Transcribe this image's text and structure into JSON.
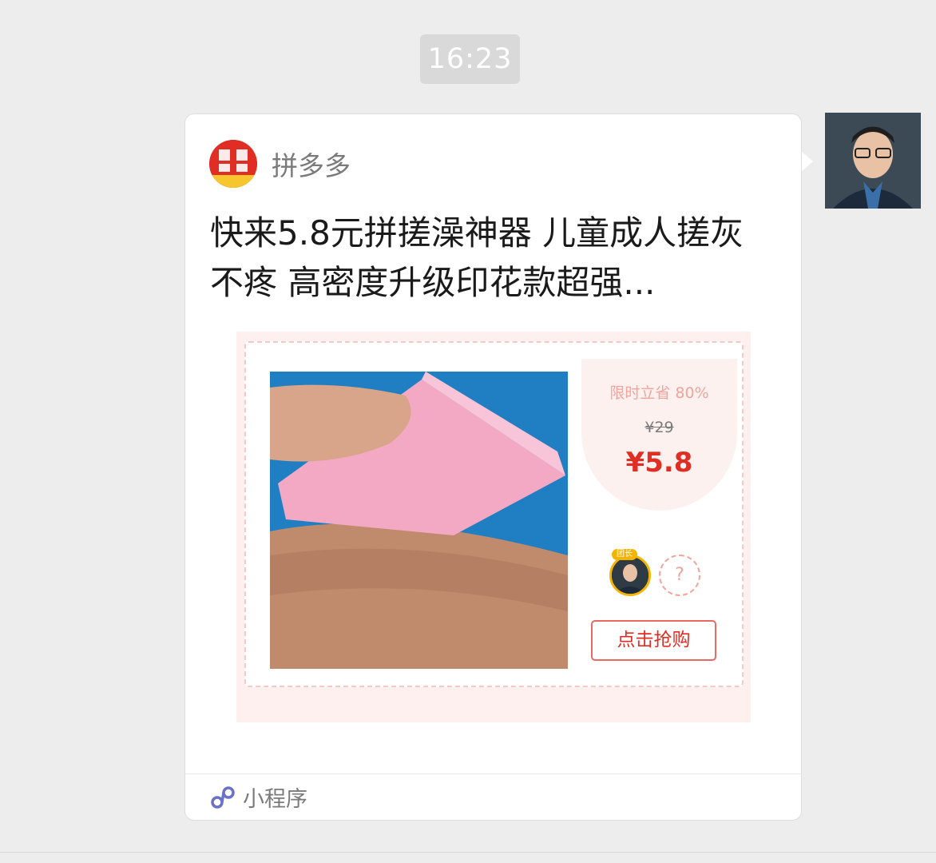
{
  "chat": {
    "timestamp": "16:23"
  },
  "message": {
    "app_name": "拼多多",
    "title": "快来5.8元拼搓澡神器 儿童成人搓灰不疼 高密度升级印花款超强...",
    "preview": {
      "discount_label": "限时立省 80%",
      "original_price": "¥29",
      "sale_price": "¥5.8",
      "leader_tag": "团长",
      "empty_slot": "?",
      "buy_button": "点击抢购"
    },
    "footer_label": "小程序"
  },
  "colors": {
    "brand_red": "#e02e24",
    "bubble_bg": "#ffffff",
    "chat_bg": "#ededed"
  }
}
